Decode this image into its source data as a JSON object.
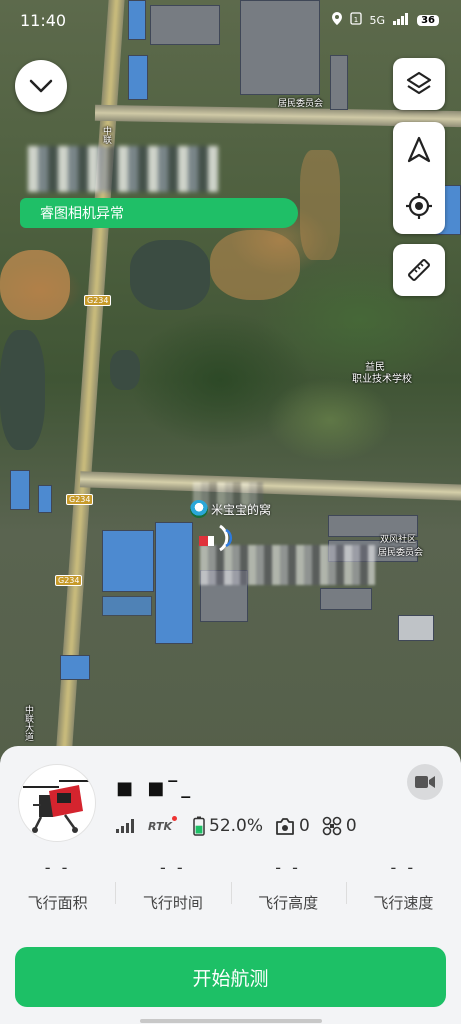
{
  "status_bar": {
    "time": "11:40",
    "network": "5G",
    "battery": "36"
  },
  "map": {
    "labels": {
      "village_committee_top": "居民委员会",
      "school_1": "益民",
      "school_2": "职业技术学校",
      "village_committee_bottom_1": "双风社区",
      "village_committee_bottom_2": "居民委员会",
      "road_name_1": "中联",
      "road_name_2": "中联大道"
    },
    "road_badges": [
      "G234",
      "G234",
      "G234"
    ],
    "watermark": "米宝宝的窝",
    "camera_error": "睿图相机异常"
  },
  "icons": {
    "collapse": "chevron-down-icon",
    "layers": "layers-icon",
    "navigate": "navigation-arrow-icon",
    "locate": "locate-target-icon",
    "measure": "ruler-icon",
    "video": "video-camera-icon"
  },
  "device": {
    "name": "■ ■‾_",
    "rtk": "RTK",
    "battery_percent": "52.0%",
    "photo_count": "0",
    "drone_count": "0",
    "battery_level": 0.52
  },
  "stats": [
    {
      "value": "- -",
      "label": "飞行面积"
    },
    {
      "value": "- -",
      "label": "飞行时间"
    },
    {
      "value": "- -",
      "label": "飞行高度"
    },
    {
      "value": "- -",
      "label": "飞行速度"
    }
  ],
  "start_button": "开始航测",
  "colors": {
    "accent": "#1dc066",
    "tag": "#1fbf67"
  }
}
